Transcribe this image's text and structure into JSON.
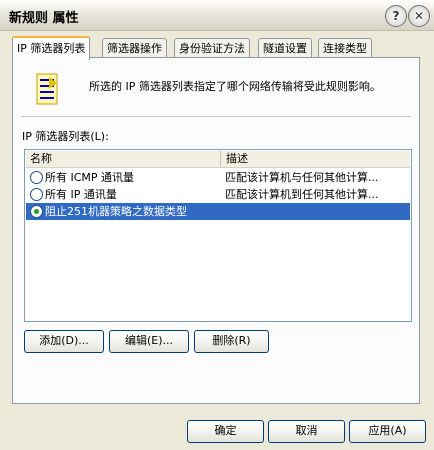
{
  "window": {
    "title": "新规则 属性"
  },
  "titlebar": {
    "help_glyph": "?",
    "close_glyph": "✕"
  },
  "tabs": [
    {
      "label": "IP 筛选器列表",
      "active": true
    },
    {
      "label": "筛选器操作",
      "active": false
    },
    {
      "label": "身份验证方法",
      "active": false
    },
    {
      "label": "隧道设置",
      "active": false
    },
    {
      "label": "连接类型",
      "active": false
    }
  ],
  "panel": {
    "icon": "filter-list-icon",
    "description": "所选的 IP 筛选器列表指定了哪个网络传输将受此规则影响。",
    "list_label": "IP 筛选器列表(L):",
    "columns": {
      "name": "名称",
      "description": "描述"
    },
    "rows": [
      {
        "name": "所有 ICMP 通讯量",
        "description": "匹配该计算机与任何其他计算...",
        "selected": false
      },
      {
        "name": "所有 IP 通讯量",
        "description": "匹配该计算机到任何其他计算...",
        "selected": false
      },
      {
        "name": "阻止251机器策略之数据类型",
        "description": "",
        "selected": true
      }
    ],
    "buttons": {
      "add": "添加(D)...",
      "edit": "编辑(E)...",
      "remove": "删除(R)"
    }
  },
  "footer": {
    "ok": "确定",
    "cancel": "取消",
    "apply": "应用(A)"
  }
}
